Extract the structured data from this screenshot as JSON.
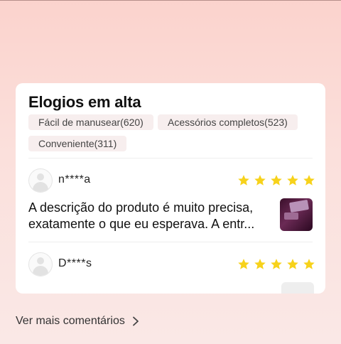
{
  "section": {
    "title": "Elogios em alta",
    "tags": [
      {
        "label": "Fácil de manusear(620)"
      },
      {
        "label": "Acessórios completos(523)"
      },
      {
        "label": "Conveniente(311)"
      }
    ]
  },
  "reviews": [
    {
      "username": "n****a",
      "rating": 5,
      "text_line1": "A descrição do produto é muito precisa,",
      "text_line2": "exatamente o que eu esperava. A entr..."
    },
    {
      "username": "D****s",
      "rating": 5
    }
  ],
  "footer": {
    "more_label": "Ver mais comentários",
    "icon": "chevron-right-icon"
  },
  "colors": {
    "star": "#f7d21b",
    "tag_bg": "#f7eeee",
    "background_top": "#fbd3cd"
  }
}
